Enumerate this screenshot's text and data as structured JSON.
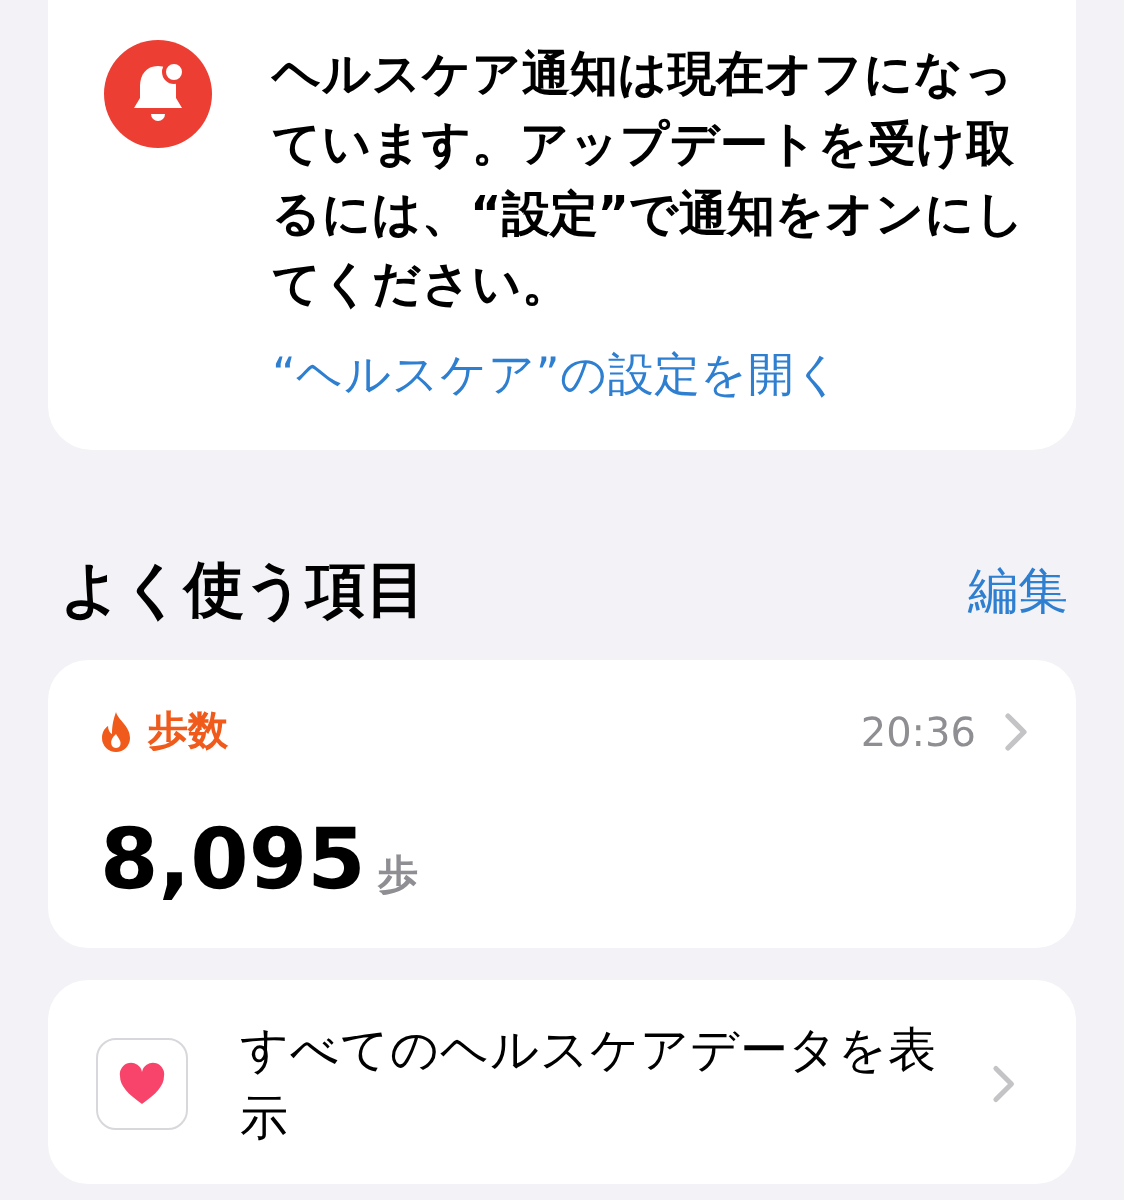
{
  "notice": {
    "message": "ヘルスケア通知は現在オフになっています。アップデートを受け取るには、“設定”で通知をオンにしてください。",
    "link": "“ヘルスケア”の設定を開く"
  },
  "favorites": {
    "title": "よく使う項目",
    "edit": "編集",
    "metric": {
      "name": "歩数",
      "time": "20:36",
      "value": "8,095",
      "unit": "歩"
    },
    "all_data": {
      "label": "すべてのヘルスケアデータを表示"
    }
  }
}
